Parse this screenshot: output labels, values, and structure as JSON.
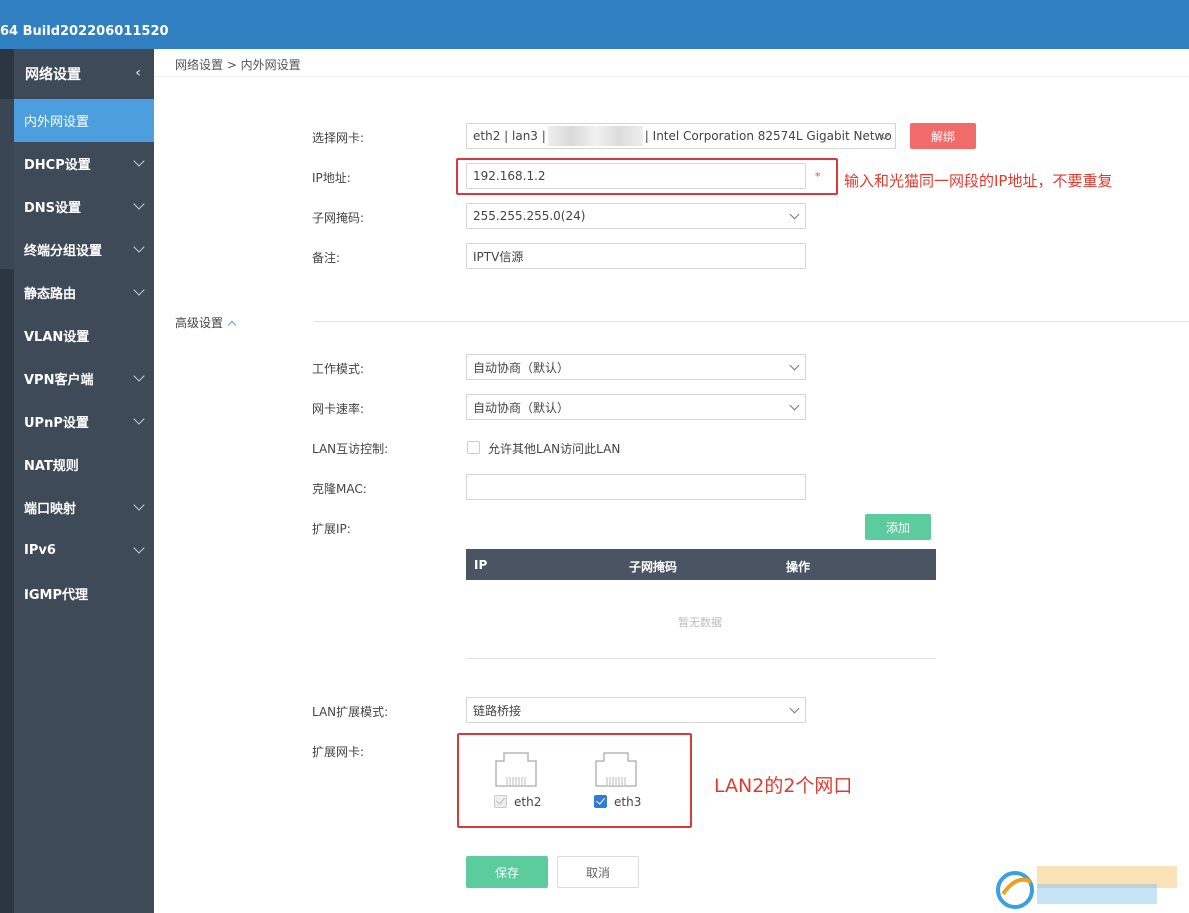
{
  "header": {
    "build": "64 Build202206011520"
  },
  "sidebar": {
    "title": "网络设置",
    "items": [
      {
        "label": "内外网设置"
      },
      {
        "label": "DHCP设置"
      },
      {
        "label": "DNS设置"
      },
      {
        "label": "终端分组设置"
      },
      {
        "label": "静态路由"
      },
      {
        "label": "VLAN设置"
      },
      {
        "label": "VPN客户端"
      },
      {
        "label": "UPnP设置"
      },
      {
        "label": "NAT规则"
      },
      {
        "label": "端口映射"
      },
      {
        "label": "IPv6"
      },
      {
        "label": "IGMP代理"
      }
    ]
  },
  "breadcrumb": "网络设置 > 内外网设置",
  "form": {
    "nic_label": "选择网卡:",
    "nic_value_left": "eth2 | lan3 |",
    "nic_value_right": "| Intel Corporation 82574L Gigabit Netwo",
    "unbind_button": "解绑",
    "ip_label": "IP地址:",
    "ip_value": "192.168.1.2",
    "ip_required": "*",
    "mask_label": "子网掩码:",
    "mask_value": "255.255.255.0(24)",
    "remark_label": "备注:",
    "remark_value": "IPTV信源"
  },
  "annotations": {
    "ip_note": "输入和光猫同一网段的IP地址，不要重复",
    "lan2_note": "LAN2的2个网口"
  },
  "advanced": {
    "title": "高级设置",
    "work_mode_label": "工作模式:",
    "work_mode_value": "自动协商（默认）",
    "nic_speed_label": "网卡速率:",
    "nic_speed_value": "自动协商（默认）",
    "lan_access_label": "LAN互访控制:",
    "lan_access_option": "允许其他LAN访问此LAN",
    "clone_mac_label": "克隆MAC:",
    "clone_mac_value": "",
    "ext_ip_label": "扩展IP:",
    "add_button": "添加",
    "table_headers": [
      "IP",
      "子网掩码",
      "操作"
    ],
    "table_empty": "暂无数据",
    "lan_ext_mode_label": "LAN扩展模式:",
    "lan_ext_mode_value": "链路桥接",
    "ext_nic_label": "扩展网卡:",
    "ports": [
      {
        "name": "eth2",
        "checked": true,
        "disabled": true
      },
      {
        "name": "eth3",
        "checked": true,
        "disabled": false
      }
    ]
  },
  "actions": {
    "save": "保存",
    "cancel": "取消"
  },
  "colors": {
    "topbar": "#2f7fc1",
    "sidebar": "#3e4a57",
    "active": "#4c9fdc",
    "danger": "#f26b6b",
    "success": "#5ccb9d",
    "annotation": "#e03a2f"
  }
}
